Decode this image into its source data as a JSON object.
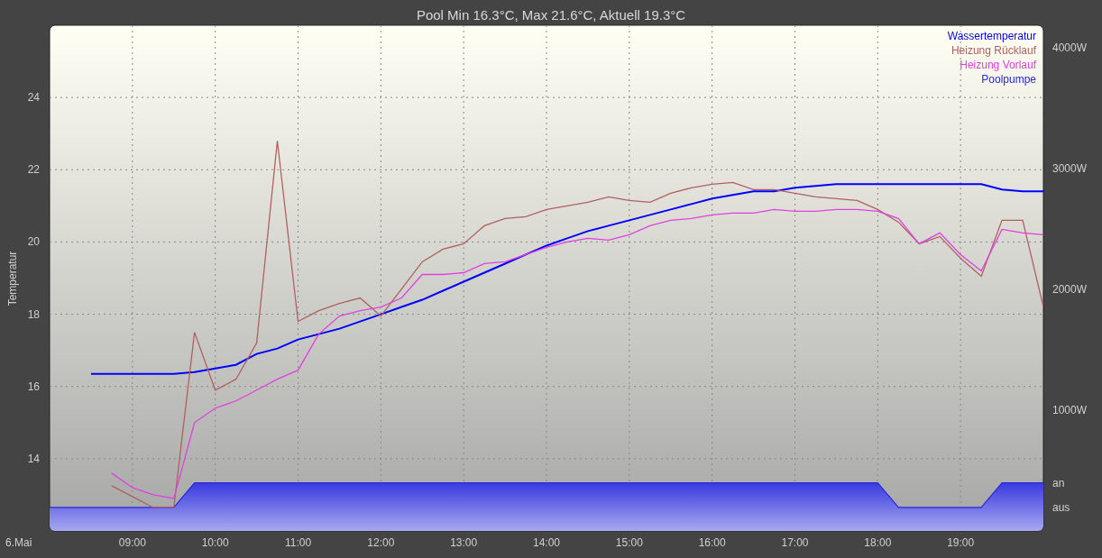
{
  "chart_data": {
    "type": "line",
    "title": "Pool Min 16.3°C, Max 21.6°C, Aktuell 19.3°C",
    "ylabel": "Temperatur",
    "grid": true,
    "x": [
      8,
      8.25,
      8.5,
      8.75,
      9,
      9.25,
      9.5,
      9.75,
      10,
      10.25,
      10.5,
      10.75,
      11,
      11.25,
      11.5,
      11.75,
      12,
      12.25,
      12.5,
      12.75,
      13,
      13.25,
      13.5,
      13.75,
      14,
      14.25,
      14.5,
      14.75,
      15,
      15.25,
      15.5,
      15.75,
      16,
      16.25,
      16.5,
      16.75,
      17,
      17.25,
      17.5,
      17.75,
      18,
      18.25,
      18.5,
      18.75,
      19,
      19.25,
      19.5,
      19.75,
      20
    ],
    "xlim": [
      8,
      20
    ],
    "ylim": [
      12,
      26
    ],
    "xticks": [
      {
        "value": 9,
        "label": "09:00"
      },
      {
        "value": 10,
        "label": "10:00"
      },
      {
        "value": 11,
        "label": "11:00"
      },
      {
        "value": 12,
        "label": "12:00"
      },
      {
        "value": 13,
        "label": "13:00"
      },
      {
        "value": 14,
        "label": "14:00"
      },
      {
        "value": 15,
        "label": "15:00"
      },
      {
        "value": 16,
        "label": "16:00"
      },
      {
        "value": 17,
        "label": "17:00"
      },
      {
        "value": 18,
        "label": "18:00"
      },
      {
        "value": 19,
        "label": "19:00"
      }
    ],
    "yticks": [
      14,
      16,
      18,
      20,
      22,
      24
    ],
    "y2lim": [
      0,
      4187
    ],
    "y2ticks": [
      {
        "value": 1000,
        "label": "1000W"
      },
      {
        "value": 2000,
        "label": "2000W"
      },
      {
        "value": 3000,
        "label": "3000W"
      },
      {
        "value": 4000,
        "label": "4000W"
      }
    ],
    "series": [
      {
        "name": "Wassertemperatur",
        "color": "#0000ff",
        "values": [
          null,
          null,
          16.35,
          16.35,
          16.35,
          16.35,
          16.35,
          16.4,
          16.5,
          16.6,
          16.9,
          17.05,
          17.3,
          17.45,
          17.6,
          17.8,
          18.0,
          18.2,
          18.4,
          18.65,
          18.9,
          19.15,
          19.4,
          19.65,
          19.9,
          20.1,
          20.3,
          20.45,
          20.6,
          20.75,
          20.9,
          21.05,
          21.2,
          21.3,
          21.4,
          21.4,
          21.5,
          21.55,
          21.6,
          21.6,
          21.6,
          21.6,
          21.6,
          21.6,
          21.6,
          21.6,
          21.45,
          21.4,
          21.4
        ]
      },
      {
        "name": "Heizung Rücklauf",
        "color": "#b06060",
        "values": [
          null,
          null,
          null,
          13.25,
          12.95,
          12.65,
          12.65,
          17.5,
          15.9,
          16.2,
          17.2,
          22.8,
          17.8,
          18.1,
          18.3,
          18.45,
          17.95,
          18.7,
          19.45,
          19.8,
          19.95,
          20.45,
          20.65,
          20.7,
          20.9,
          21.0,
          21.1,
          21.25,
          21.15,
          21.1,
          21.35,
          21.5,
          21.6,
          21.65,
          21.45,
          21.45,
          21.35,
          21.25,
          21.2,
          21.15,
          20.9,
          20.55,
          19.95,
          20.15,
          19.55,
          19.05,
          20.6,
          20.6,
          18.2
        ]
      },
      {
        "name": "Heizung Vorlauf",
        "color": "#e040e0",
        "values": [
          null,
          null,
          null,
          13.6,
          13.2,
          13.0,
          12.9,
          15.0,
          15.4,
          15.6,
          15.9,
          16.2,
          16.45,
          17.45,
          17.95,
          18.1,
          18.2,
          18.45,
          19.1,
          19.1,
          19.15,
          19.4,
          19.45,
          19.65,
          19.85,
          20.0,
          20.1,
          20.05,
          20.2,
          20.45,
          20.6,
          20.65,
          20.75,
          20.8,
          20.8,
          20.9,
          20.85,
          20.85,
          20.9,
          20.9,
          20.85,
          20.65,
          19.95,
          20.25,
          19.65,
          19.2,
          20.35,
          20.25,
          20.2
        ]
      },
      {
        "name": "Poolpumpe",
        "color": "#2828d8",
        "values": [
          12.65,
          12.65,
          12.65,
          12.65,
          12.65,
          12.65,
          12.65,
          13.33,
          13.33,
          13.33,
          13.33,
          13.33,
          13.33,
          13.33,
          13.33,
          13.33,
          13.33,
          13.33,
          13.33,
          13.33,
          13.33,
          13.33,
          13.33,
          13.33,
          13.33,
          13.33,
          13.33,
          13.33,
          13.33,
          13.33,
          13.33,
          13.33,
          13.33,
          13.33,
          13.33,
          13.33,
          13.33,
          13.33,
          13.33,
          13.33,
          13.33,
          12.65,
          12.65,
          12.65,
          12.65,
          12.65,
          13.33,
          13.33,
          13.33
        ]
      }
    ]
  },
  "state_labels": {
    "on": "an",
    "off": "aus"
  },
  "date_label": "6.Mai"
}
